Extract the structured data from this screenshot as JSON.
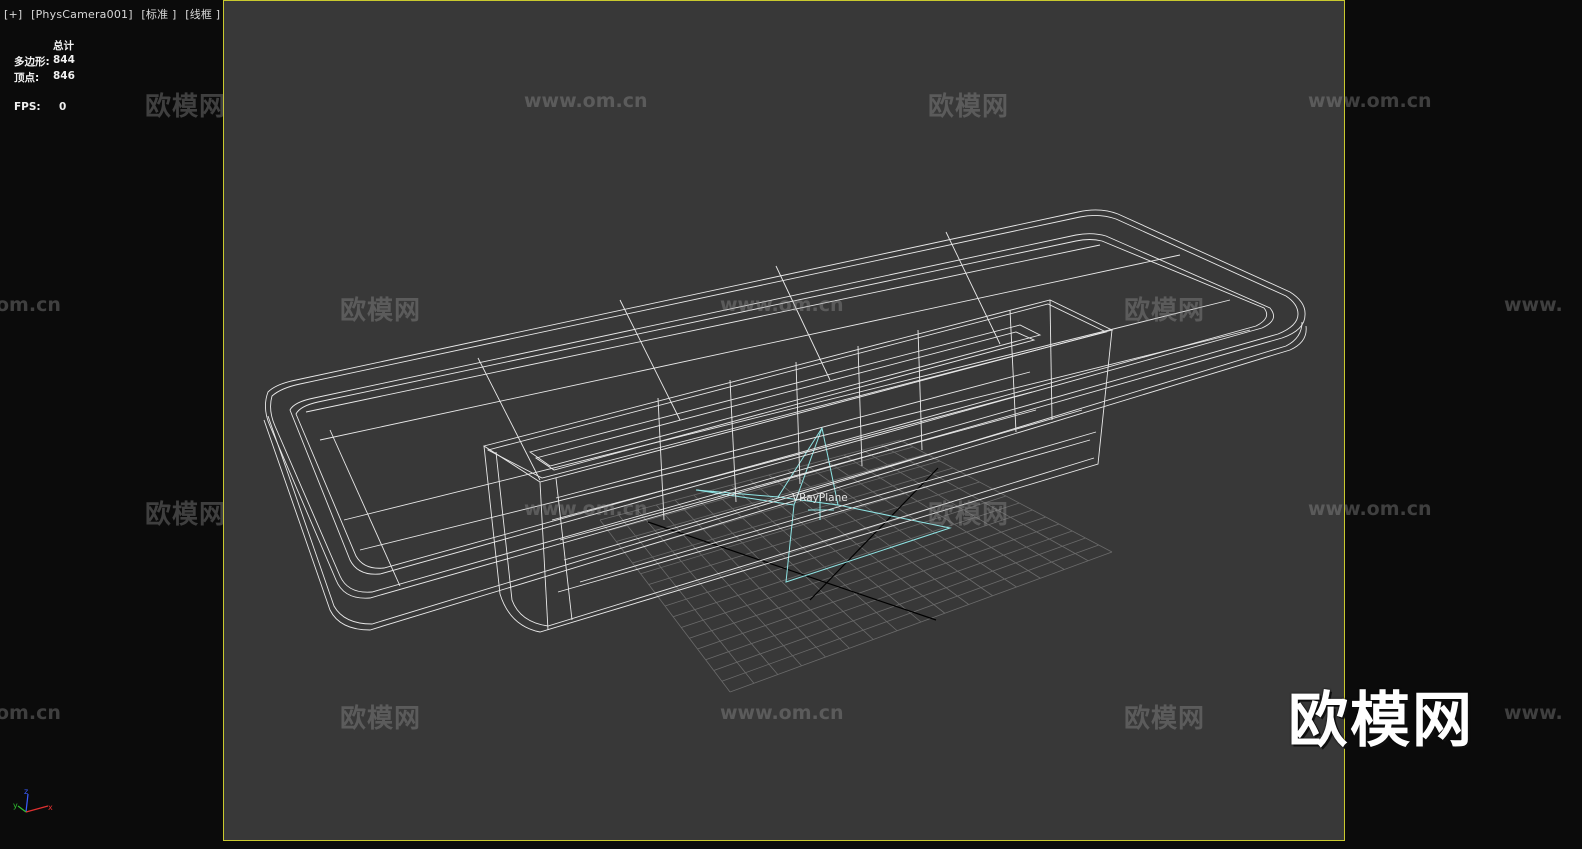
{
  "viewport": {
    "label_parts": [
      "[+]",
      "[PhysCamera001]",
      "[标准 ]",
      "[线框 ]"
    ],
    "frame_color": "#c9c92e",
    "background_color": "#383838",
    "wire_color": "#ffffff",
    "helper_color": "#8fe6e6"
  },
  "stats": {
    "header": "总计",
    "polygons_label": "多边形:",
    "polygons_value": "844",
    "vertices_label": "顶点:",
    "vertices_value": "846",
    "fps_label": "FPS:",
    "fps_value": "0"
  },
  "scene": {
    "object_label": "VRayPlane",
    "axis_icon": "xyz-axis-tripod-icon"
  },
  "watermarks": {
    "brand_cn": "欧模网",
    "brand_url": "www.om.cn",
    "big_logo": "欧模网"
  }
}
